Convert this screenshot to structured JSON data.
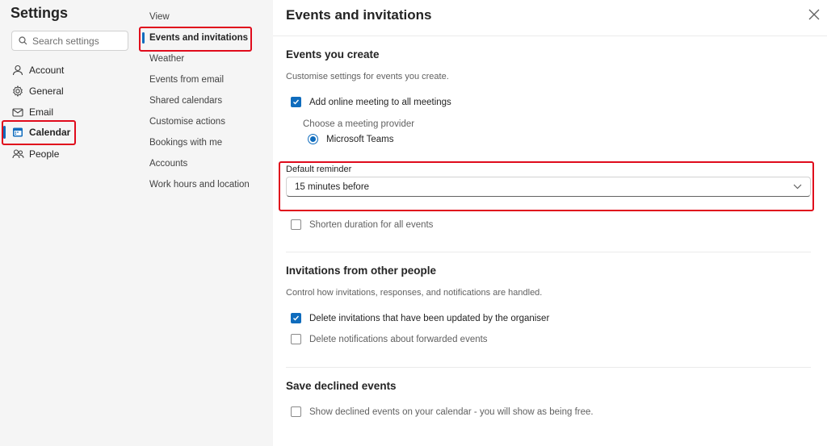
{
  "nav": {
    "title": "Settings",
    "search_placeholder": "Search settings",
    "items": [
      {
        "label": "Account",
        "icon": "person-icon"
      },
      {
        "label": "General",
        "icon": "gear-icon"
      },
      {
        "label": "Email",
        "icon": "mail-icon"
      },
      {
        "label": "Calendar",
        "icon": "calendar-icon"
      },
      {
        "label": "People",
        "icon": "people-icon"
      }
    ]
  },
  "subnav": {
    "items": [
      "View",
      "Events and invitations",
      "Weather",
      "Events from email",
      "Shared calendars",
      "Customise actions",
      "Bookings with me",
      "Accounts",
      "Work hours and location"
    ]
  },
  "main": {
    "title": "Events and invitations",
    "events_you_create": {
      "title": "Events you create",
      "description": "Customise settings for events you create.",
      "online_meeting_label": "Add online meeting to all meetings",
      "provider_label": "Choose a meeting provider",
      "provider_value": "Microsoft Teams",
      "reminder_label": "Default reminder",
      "reminder_value": "15 minutes before",
      "shorten_label": "Shorten duration for all events"
    },
    "invitations": {
      "title": "Invitations from other people",
      "description": "Control how invitations, responses, and notifications are handled.",
      "delete_updated_label": "Delete invitations that have been updated by the organiser",
      "delete_forwarded_label": "Delete notifications about forwarded events"
    },
    "declined": {
      "title": "Save declined events",
      "show_declined_label": "Show declined events on your calendar - you will show as being free."
    }
  },
  "colors": {
    "accent": "#0f6cbd",
    "highlight": "#e00b1c"
  }
}
